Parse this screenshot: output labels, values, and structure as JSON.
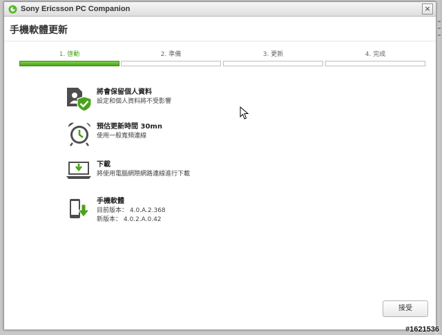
{
  "window": {
    "title": "Sony Ericsson PC Companion",
    "close_label": "×"
  },
  "page": {
    "title": "手機軟體更新"
  },
  "steps": [
    {
      "label": "1. 啓動",
      "active": true
    },
    {
      "label": "2. 準備",
      "active": false
    },
    {
      "label": "3. 更新",
      "active": false
    },
    {
      "label": "4. 完成",
      "active": false
    }
  ],
  "items": [
    {
      "icon": "personal-data-shield-icon",
      "title": "將會保留個人資料",
      "desc": "設定和個人資料將不受影響"
    },
    {
      "icon": "alarm-clock-icon",
      "title": "預估更新時間 30mn",
      "desc": "使用一般寬頻連線"
    },
    {
      "icon": "laptop-download-icon",
      "title": "下載",
      "desc": "將使用電腦網際網路連線進行下載"
    },
    {
      "icon": "phone-download-icon",
      "title": "手機軟體",
      "current_version": "目前版本： 4.0.A.2.368",
      "new_version": "新版本： 4.0.2.A.0.42"
    }
  ],
  "footer": {
    "accept_label": "接受"
  },
  "watermark": "#1621536",
  "colors": {
    "accent": "#4aa21a",
    "icon_dark": "#4d4d4d"
  }
}
